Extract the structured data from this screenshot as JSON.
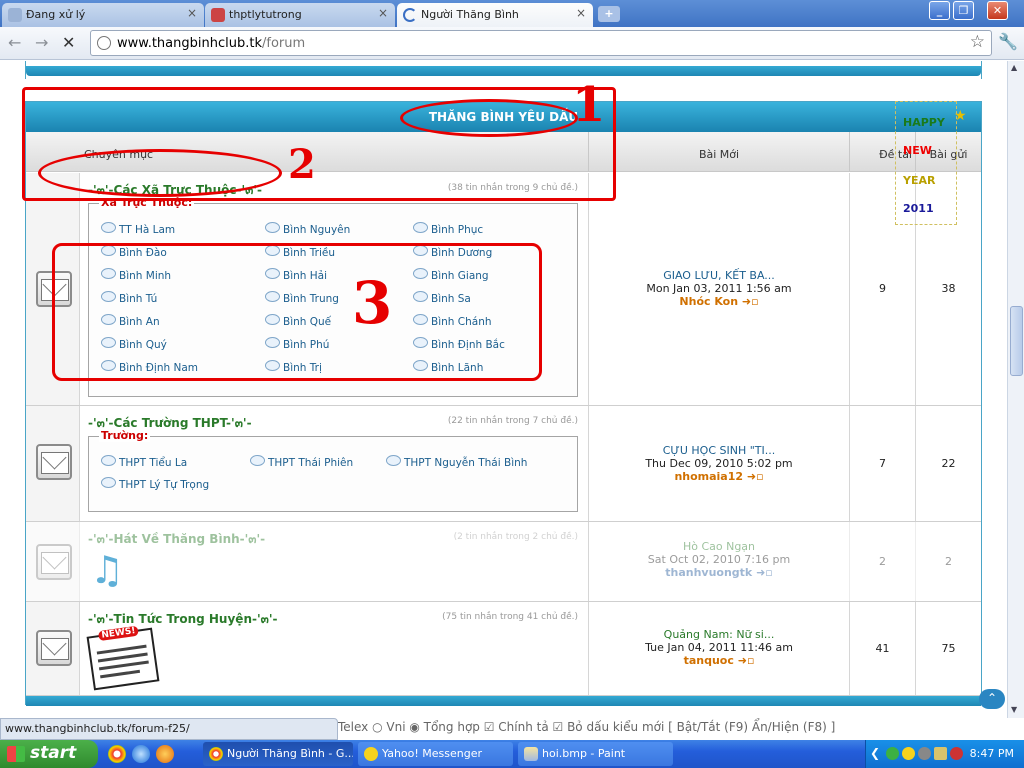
{
  "browser": {
    "tabs": [
      {
        "label": "Đang xử lý",
        "active": false
      },
      {
        "label": "thptlytutrong",
        "active": false
      },
      {
        "label": "Người Thăng Bình",
        "active": true
      }
    ],
    "url_host": "www.thangbinhclub.tk",
    "url_path": "/forum",
    "status_url": "www.thangbinhclub.tk/forum-f25/"
  },
  "forum": {
    "category_title": "THĂNG BÌNH YÊU DẤU",
    "columns": {
      "forum": "Chuyên mục",
      "last_post": "Bài Mới",
      "topics": "Đề tài",
      "posts": "Bài gửi"
    },
    "rows": [
      {
        "title": "-'๓'-Các Xã Trực Thuộc-'๓'-",
        "stats": "(38 tin nhắn trong 9 chủ đề.)",
        "sub_label": "Xã Trực Thuộc:",
        "subforums": [
          "TT Hà Lam",
          "Bình Nguyên",
          "Bình Phục",
          "Bình Đào",
          "Bình Triều",
          "Bình Dương",
          "Bình Minh",
          "Bình Hải",
          "Bình Giang",
          "Bình Tú",
          "Bình Trung",
          "Bình Sa",
          "Bình An",
          "Bình Quế",
          "Bình Chánh",
          "Bình Quý",
          "Bình Phú",
          "Bình Định Bắc",
          "Bình Định Nam",
          "Bình Trị",
          "Bình Lãnh"
        ],
        "last_title": "GIAO LƯU, KẾT BA...",
        "last_date": "Mon Jan 03, 2011 1:56 am",
        "last_user": "Nhóc Kon",
        "topics": "9",
        "posts": "38"
      },
      {
        "title": "-'๓'-Các Trường THPT-'๓'-",
        "stats": "(22 tin nhắn trong 7 chủ đề.)",
        "sub_label": "Trường:",
        "subforums": [
          "THPT Tiểu La",
          "THPT Thái Phiên",
          "THPT Nguyễn Thái Bình",
          "THPT Lý Tự Trọng"
        ],
        "last_title": "CỰU HỌC SINH \"TI...",
        "last_date": "Thu Dec 09, 2010 5:02 pm",
        "last_user": "nhomaia12",
        "topics": "7",
        "posts": "22"
      },
      {
        "title": "-'๓'-Hát Về Thăng Bình-'๓'-",
        "stats": "(2 tin nhắn trong 2 chủ đề.)",
        "last_title": "Hò Cao Ngạn",
        "last_date": "Sat Oct 02, 2010 7:16 pm",
        "last_user": "thanhvuongtk",
        "topics": "2",
        "posts": "2"
      },
      {
        "title": "-'๓'-Tin Tức Trong Huyện-'๓'-",
        "stats": "(75 tin nhắn trong 41 chủ đề.)",
        "last_title": "Quảng Nam: Nữ si...",
        "last_date": "Tue Jan 04, 2011 11:46 am",
        "last_user": "tanquoc",
        "topics": "41",
        "posts": "75"
      }
    ],
    "new_year": [
      "HAPPY",
      "NEW",
      "YEAR",
      "2011"
    ],
    "news_badge": "NEWS!"
  },
  "annotations": [
    "1",
    "2",
    "3"
  ],
  "ime_bar": "Telex  ○ Vni  ◉ Tổng hợp  ☑ Chính tả  ☑ Bỏ dấu kiểu mới [ Bật/Tắt (F9) Ẩn/Hiện (F8) ]",
  "taskbar": {
    "start": "start",
    "buttons": [
      "Người Thăng Bình - G...",
      "Yahoo! Messenger",
      "hoi.bmp - Paint"
    ],
    "clock": "8:47 PM"
  }
}
